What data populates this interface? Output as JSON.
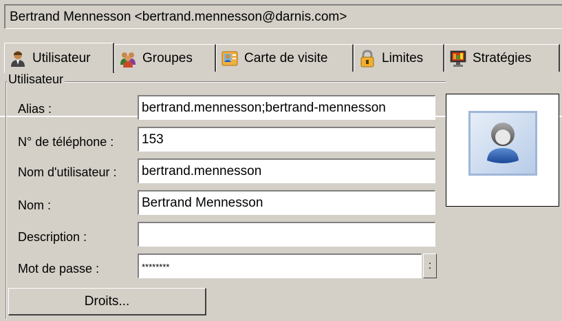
{
  "window": {
    "title": "Bertrand Mennesson <bertrand.mennesson@darnis.com>"
  },
  "tabs": [
    {
      "label": "Utilisateur",
      "icon": "user-icon",
      "active": true
    },
    {
      "label": "Groupes",
      "icon": "groups-icon",
      "active": false
    },
    {
      "label": "Carte de visite",
      "icon": "business-card-icon",
      "active": false
    },
    {
      "label": "Limites",
      "icon": "lock-icon",
      "active": false
    },
    {
      "label": "Stratégies",
      "icon": "monitor-icon",
      "active": false
    }
  ],
  "group": {
    "legend": "Utilisateur",
    "fields": {
      "alias": {
        "label": "Alias :",
        "value": "bertrand.mennesson;bertrand-mennesson"
      },
      "phone": {
        "label": "N° de téléphone :",
        "value": "153"
      },
      "username": {
        "label": "Nom d'utilisateur :",
        "value": "bertrand.mennesson"
      },
      "name": {
        "label": "Nom :",
        "value": "Bertrand Mennesson"
      },
      "description": {
        "label": "Description :",
        "value": ""
      },
      "password": {
        "label": "Mot de passe :",
        "value": "********",
        "button": ":"
      }
    },
    "rights_button": "Droits..."
  },
  "avatar": {
    "icon": "user-avatar-icon"
  },
  "colors": {
    "face": "#d4d0c8",
    "field_bg": "#ffffff",
    "avatar_blue": "#2c5aa8"
  }
}
